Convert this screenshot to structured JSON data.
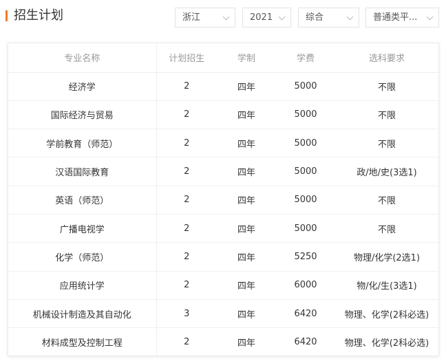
{
  "header": {
    "title": "招生计划"
  },
  "filters": {
    "province": "浙江",
    "year": "2021",
    "type": "综合",
    "batch": "普通类平..."
  },
  "table": {
    "headers": [
      "专业名称",
      "计划招生",
      "学制",
      "学费",
      "选科要求"
    ],
    "rows": [
      [
        "经济学",
        "2",
        "四年",
        "5000",
        "不限"
      ],
      [
        "国际经济与贸易",
        "2",
        "四年",
        "5000",
        "不限"
      ],
      [
        "学前教育（师范）",
        "2",
        "四年",
        "5000",
        "不限"
      ],
      [
        "汉语国际教育",
        "2",
        "四年",
        "5000",
        "政/地/史(3选1)"
      ],
      [
        "英语（师范）",
        "2",
        "四年",
        "5000",
        "不限"
      ],
      [
        "广播电视学",
        "2",
        "四年",
        "5000",
        "不限"
      ],
      [
        "化学（师范）",
        "2",
        "四年",
        "5250",
        "物理/化学(2选1)"
      ],
      [
        "应用统计学",
        "2",
        "四年",
        "6000",
        "物/化/生(3选1)"
      ],
      [
        "机械设计制造及其自动化",
        "3",
        "四年",
        "6420",
        "物理、化学(2科必选)"
      ],
      [
        "材料成型及控制工程",
        "2",
        "四年",
        "6420",
        "物理、化学(2科必选)"
      ]
    ]
  }
}
